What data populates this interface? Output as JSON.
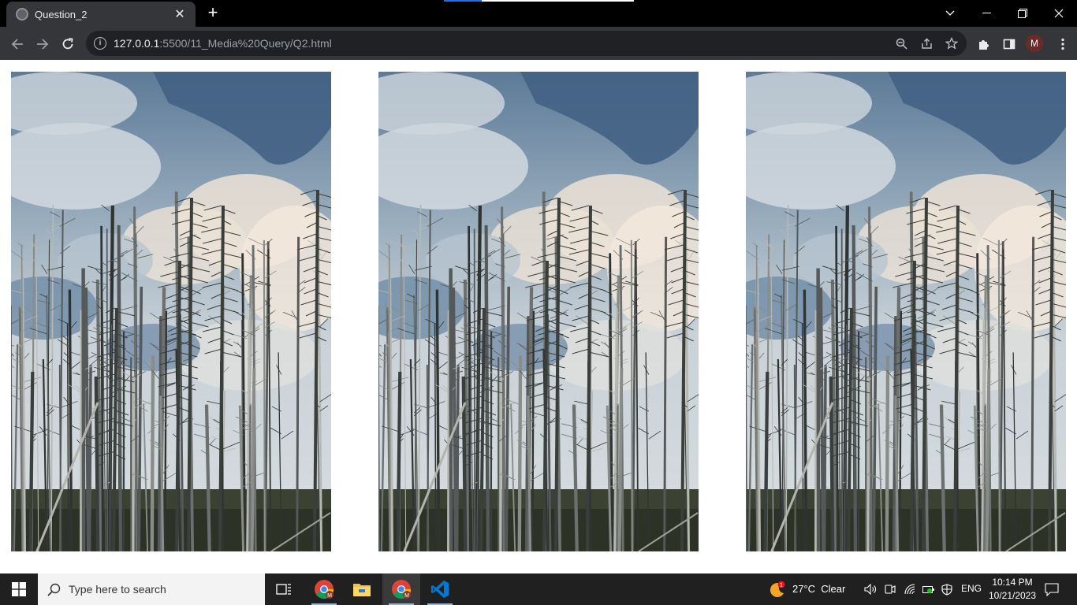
{
  "browser": {
    "tab_title": "Question_2",
    "url_host": "127.0.0.1",
    "url_path": ":5500/11_Media%20Query/Q2.html",
    "profile_initial": "M"
  },
  "page": {
    "images": [
      {
        "name": "forest-photo-1",
        "description_icon": "burned-forest-image"
      },
      {
        "name": "forest-photo-2",
        "description_icon": "burned-forest-image"
      },
      {
        "name": "forest-photo-3",
        "description_icon": "burned-forest-image"
      }
    ]
  },
  "taskbar": {
    "search_placeholder": "Type here to search",
    "weather": "27°C  Clear",
    "weather_badge": "1",
    "language": "ENG",
    "time": "10:14 PM",
    "date": "10/21/2023"
  },
  "colors": {
    "chrome_dark": "#35363a",
    "titlebar": "#000000",
    "taskbar": "#202020",
    "accent_blue": "#1a73e8"
  }
}
